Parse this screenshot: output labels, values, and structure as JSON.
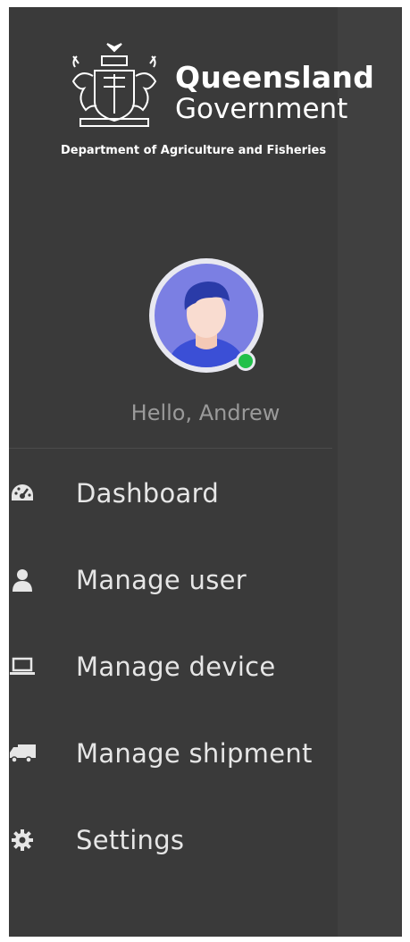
{
  "brand": {
    "title": "Queensland",
    "subtitle": "Government",
    "department": "Department of Agriculture and Fisheries",
    "crest_icon": "coat-of-arms-icon"
  },
  "user": {
    "greeting": "Hello, Andrew",
    "status": "online",
    "status_color": "#21c04a"
  },
  "nav": {
    "items": [
      {
        "label": "Dashboard",
        "icon": "dashboard-icon"
      },
      {
        "label": "Manage user",
        "icon": "user-icon"
      },
      {
        "label": "Manage device",
        "icon": "laptop-icon"
      },
      {
        "label": "Manage shipment",
        "icon": "truck-icon"
      },
      {
        "label": "Settings",
        "icon": "gear-icon"
      }
    ]
  },
  "colors": {
    "sidebar_bg": "#3a3a3a",
    "text": "#e6e6e6",
    "muted_text": "#9a9a9a",
    "avatar_bg": "#7b7fe3"
  }
}
